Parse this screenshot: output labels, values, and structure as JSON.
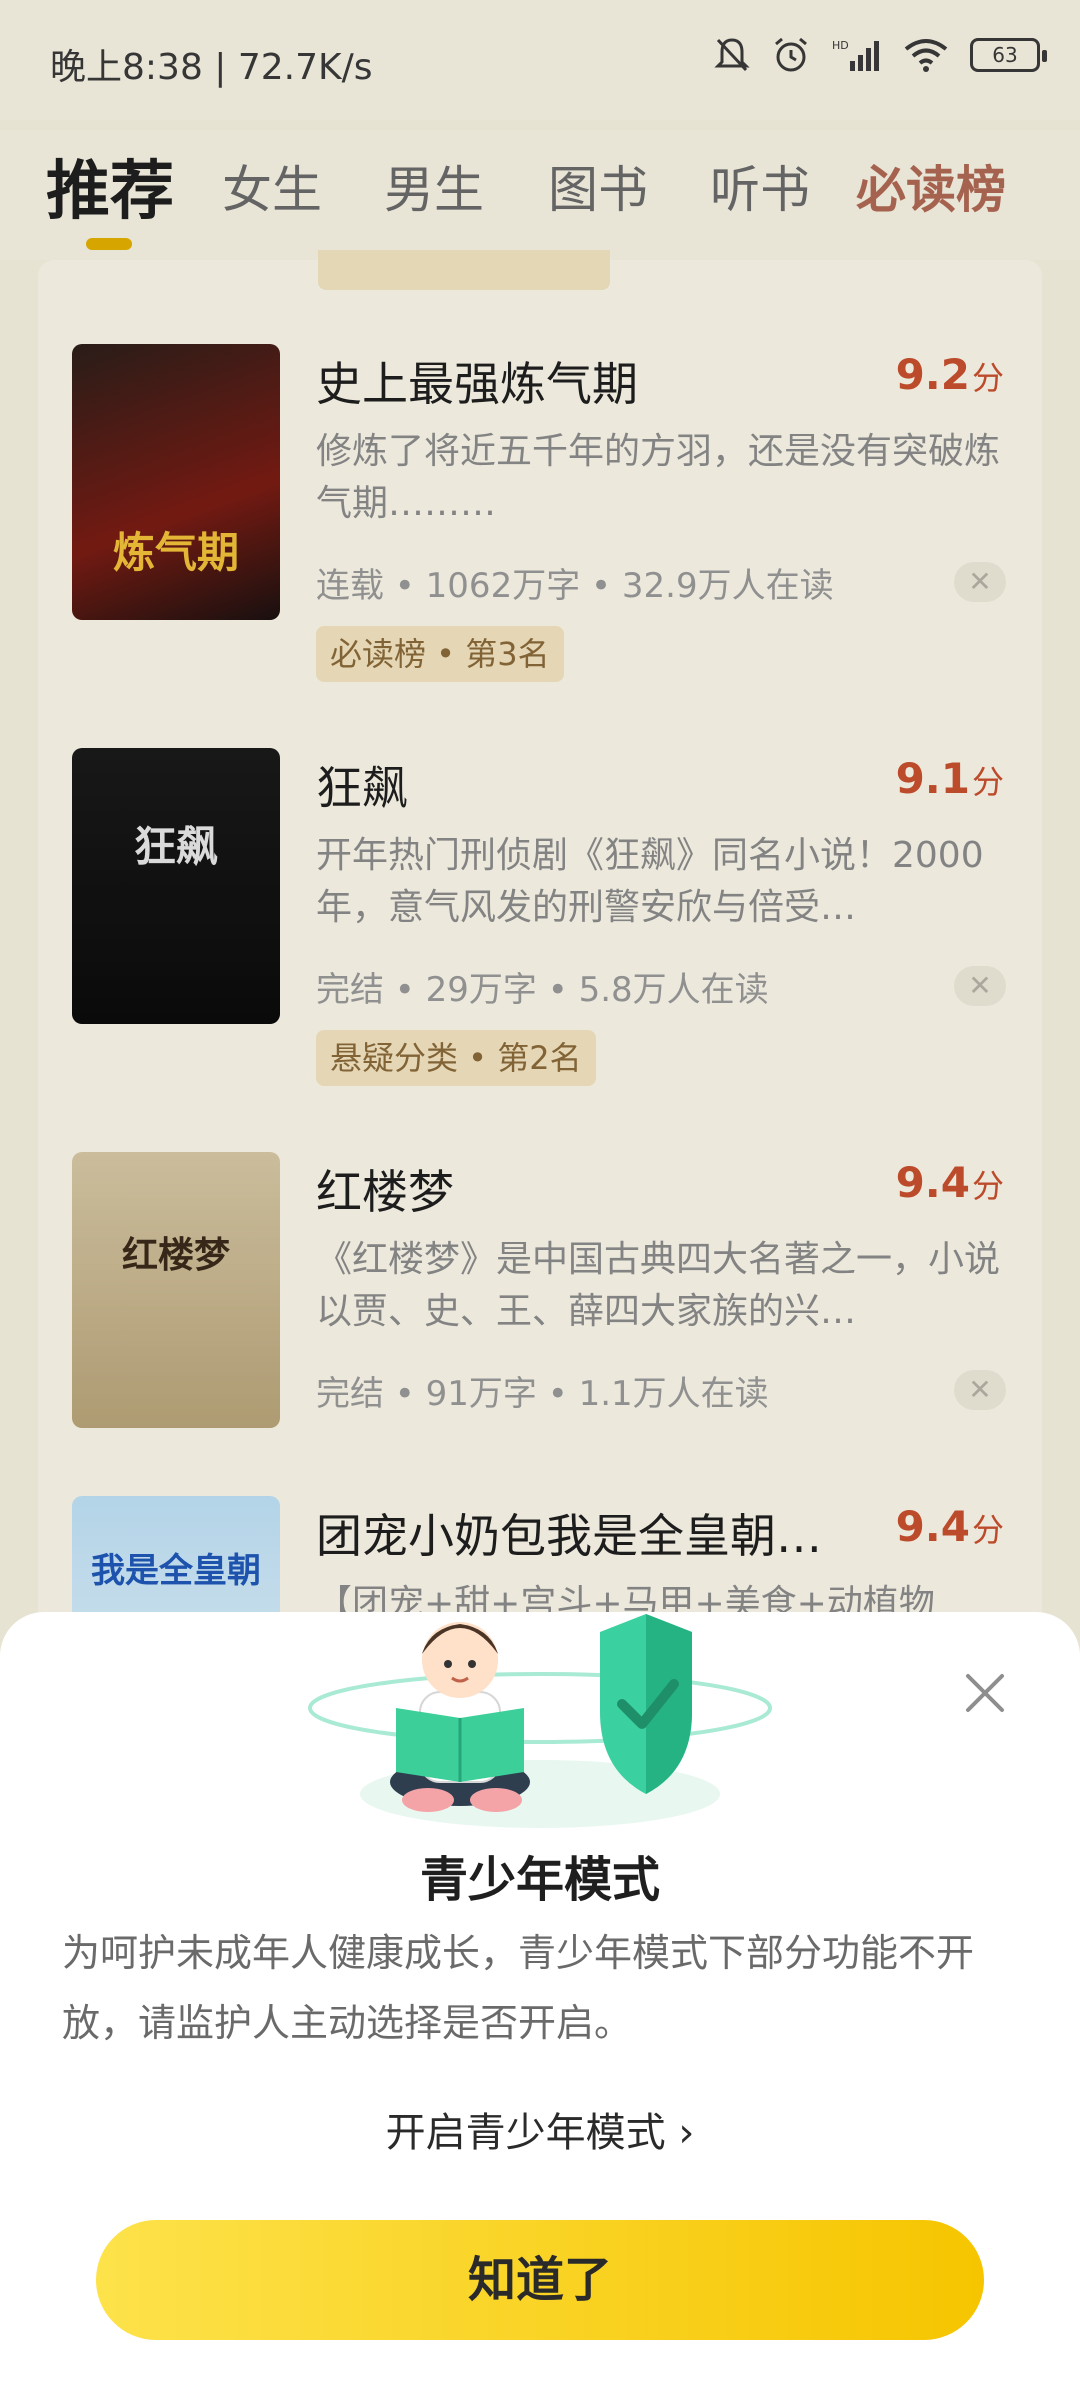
{
  "status_bar": {
    "time_speed": "晚上8:38 | 72.7K/s",
    "battery": "63"
  },
  "tabs": [
    {
      "label": "推荐"
    },
    {
      "label": "女生"
    },
    {
      "label": "男生"
    },
    {
      "label": "图书"
    },
    {
      "label": "听书"
    },
    {
      "label": "必读榜"
    }
  ],
  "books": [
    {
      "title": "史上最强炼气期",
      "score": "9.2",
      "score_unit": "分",
      "desc": "修炼了将近五千年的方羽，还是没有突破炼气期………",
      "meta": "连载 • 1062万字 • 32.9万人在读",
      "tag": "必读榜 • 第3名",
      "cover_text": "炼气期",
      "cover_colors": [
        "#2c1e1a",
        "#7a1c14"
      ]
    },
    {
      "title": "狂飙",
      "score": "9.1",
      "score_unit": "分",
      "desc": "开年热门刑侦剧《狂飙》同名小说！2000年，意气风发的刑警安欣与倍受…",
      "meta": "完结 • 29万字 • 5.8万人在读",
      "tag": "悬疑分类 • 第2名",
      "cover_text": "狂飙",
      "cover_colors": [
        "#0e0e0e",
        "#2a2a2a"
      ]
    },
    {
      "title": "红楼梦",
      "score": "9.4",
      "score_unit": "分",
      "desc": "《红楼梦》是中国古典四大名著之一，小说以贾、史、王、薛四大家族的兴…",
      "meta": "完结 • 91万字 • 1.1万人在读",
      "tag": "",
      "cover_text": "红楼梦",
      "cover_colors": [
        "#d8c9a6",
        "#b9a57a"
      ]
    },
    {
      "title": "团宠小奶包我是全皇朝…",
      "score": "9.4",
      "score_unit": "分",
      "desc": "【团宠+甜+宫斗+马甲+美食+动植物",
      "meta": "",
      "tag": "",
      "cover_text": "我是全皇朝",
      "cover_colors": [
        "#bfe2f7",
        "#e7f4fc"
      ]
    }
  ],
  "sheet": {
    "title": "青少年模式",
    "desc": "为呵护未成年人健康成长，青少年模式下部分功能不开放，请监护人主动选择是否开启。",
    "link": "开启青少年模式 ›",
    "button": "知道了"
  },
  "colors": {
    "accent_yellow": "#f6c500",
    "score_red": "#c8502e",
    "tag_bg": "#f4e5c1"
  },
  "icons": [
    "mute-bell-icon",
    "alarm-icon",
    "signal-icon",
    "wifi-icon",
    "battery-icon",
    "close-icon",
    "dismiss-icon"
  ]
}
